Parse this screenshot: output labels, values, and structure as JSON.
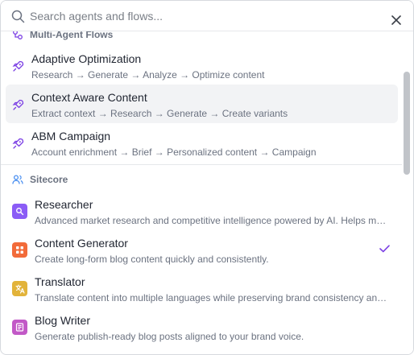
{
  "search": {
    "placeholder": "Search agents and flows..."
  },
  "colors": {
    "accent": "#7b3fe4",
    "tile_researcher": "#8b5cf6",
    "tile_content_generator": "#f26b3a",
    "tile_translator": "#e2b33a",
    "tile_blog_writer": "#c259c7",
    "sitecore_icon": "#4a8ff0"
  },
  "groups": {
    "flows": {
      "label": "Multi-Agent Flows",
      "icon": "flow-icon",
      "items": [
        {
          "title": "Adaptive Optimization",
          "desc": "Research → Generate → Analyze → Optimize content",
          "icon": "rocket-icon"
        },
        {
          "title": "Context Aware Content",
          "desc": "Extract context → Research → Generate → Create variants",
          "icon": "rocket-icon",
          "highlighted": true
        },
        {
          "title": "ABM Campaign",
          "desc": "Account enrichment → Brief → Personalized content → Campaign",
          "icon": "rocket-icon"
        }
      ]
    },
    "sitecore": {
      "label": "Sitecore",
      "icon": "users-icon",
      "items": [
        {
          "title": "Researcher",
          "desc": "Advanced market research and competitive intelligence powered by AI. Helps marketers uncover trends.",
          "icon": "research-icon"
        },
        {
          "title": "Content Generator",
          "desc": "Create long-form blog content quickly and consistently.",
          "icon": "generator-icon",
          "selected": true
        },
        {
          "title": "Translator",
          "desc": "Translate content into multiple languages while preserving brand consistency and voice across locales.",
          "icon": "translate-icon"
        },
        {
          "title": "Blog Writer",
          "desc": "Generate publish-ready blog posts aligned to your brand voice.",
          "icon": "blog-icon"
        }
      ]
    }
  }
}
